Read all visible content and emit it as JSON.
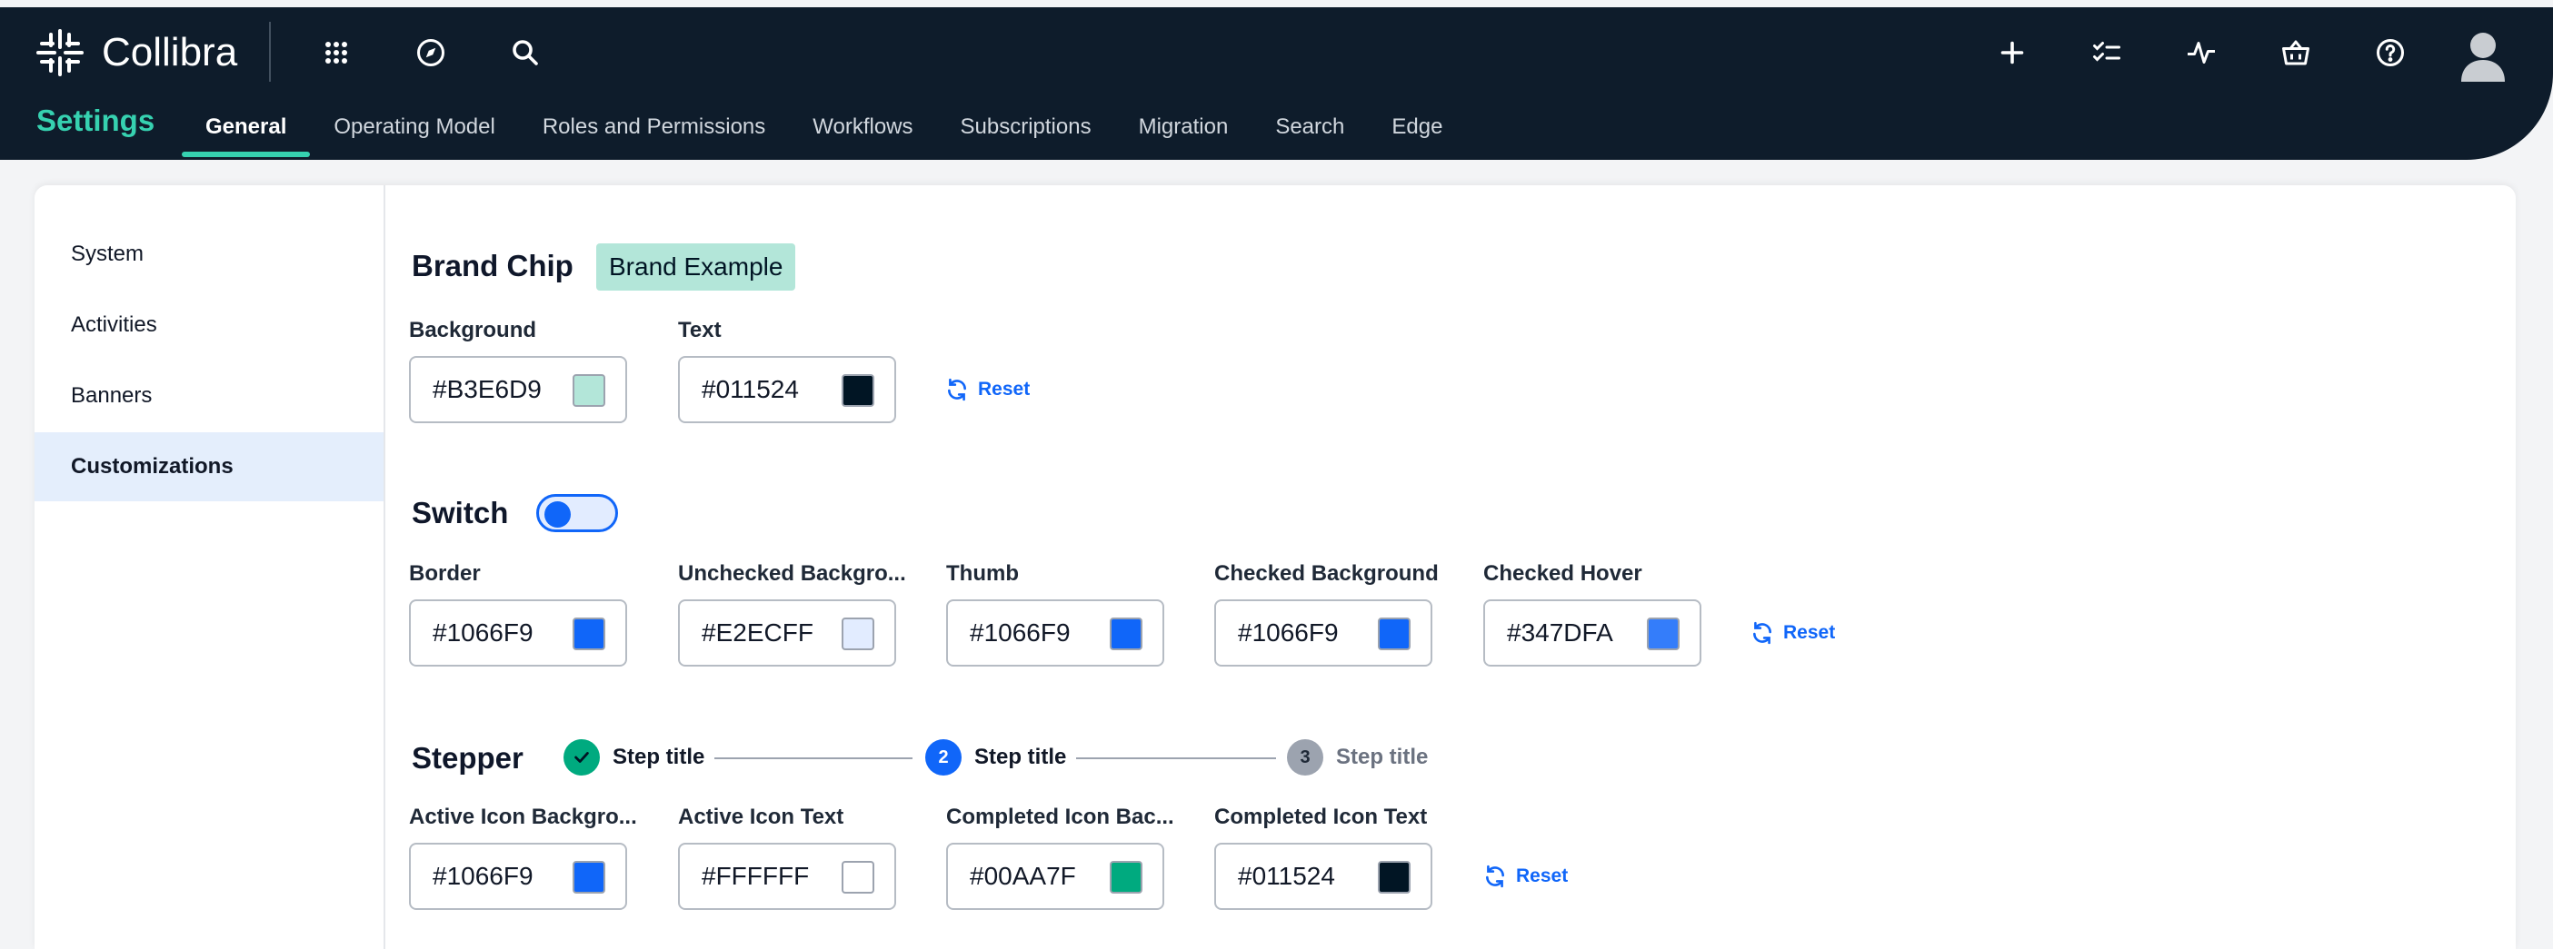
{
  "app": {
    "name": "Collibra"
  },
  "colors": {
    "topbar": "#0e1c2b",
    "accent": "#36d1b0",
    "primary": "#1066f9"
  },
  "top_icons": [
    "apps-grid-icon",
    "compass-icon",
    "search-icon",
    "plus-icon",
    "tasks-icon",
    "activity-icon",
    "basket-icon",
    "help-icon",
    "avatar-icon"
  ],
  "header": {
    "title": "Settings",
    "tabs": [
      {
        "label": "General",
        "active": true
      },
      {
        "label": "Operating Model"
      },
      {
        "label": "Roles and Permissions"
      },
      {
        "label": "Workflows"
      },
      {
        "label": "Subscriptions"
      },
      {
        "label": "Migration"
      },
      {
        "label": "Search"
      },
      {
        "label": "Edge"
      }
    ]
  },
  "sidebar": {
    "items": [
      {
        "label": "System"
      },
      {
        "label": "Activities"
      },
      {
        "label": "Banners"
      },
      {
        "label": "Customizations",
        "active": true
      }
    ]
  },
  "brand_chip": {
    "title": "Brand Chip",
    "example": "Brand Example",
    "fields": [
      {
        "label": "Background",
        "value": "#B3E6D9",
        "swatch": "#B3E6D9"
      },
      {
        "label": "Text",
        "value": "#011524",
        "swatch": "#011524"
      }
    ],
    "reset": "Reset"
  },
  "switch": {
    "title": "Switch",
    "fields": [
      {
        "label": "Border",
        "value": "#1066F9",
        "swatch": "#1066F9"
      },
      {
        "label": "Unchecked Backgro...",
        "value": "#E2ECFF",
        "swatch": "#E2ECFF"
      },
      {
        "label": "Thumb",
        "value": "#1066F9",
        "swatch": "#1066F9"
      },
      {
        "label": "Checked Background",
        "value": "#1066F9",
        "swatch": "#1066F9"
      },
      {
        "label": "Checked Hover",
        "value": "#347DFA",
        "swatch": "#347DFA"
      }
    ],
    "reset": "Reset"
  },
  "stepper": {
    "title": "Stepper",
    "steps": [
      {
        "label": "Step title",
        "state": "completed",
        "icon": "check-icon"
      },
      {
        "label": "Step title",
        "state": "active",
        "number": "2"
      },
      {
        "label": "Step title",
        "state": "pending",
        "number": "3"
      }
    ],
    "fields": [
      {
        "label": "Active Icon Backgro...",
        "value": "#1066F9",
        "swatch": "#1066F9"
      },
      {
        "label": "Active Icon Text",
        "value": "#FFFFFF",
        "swatch": "#FFFFFF"
      },
      {
        "label": "Completed Icon Bac...",
        "value": "#00AA7F",
        "swatch": "#00AA7F"
      },
      {
        "label": "Completed Icon Text",
        "value": "#011524",
        "swatch": "#011524"
      }
    ],
    "reset": "Reset"
  }
}
